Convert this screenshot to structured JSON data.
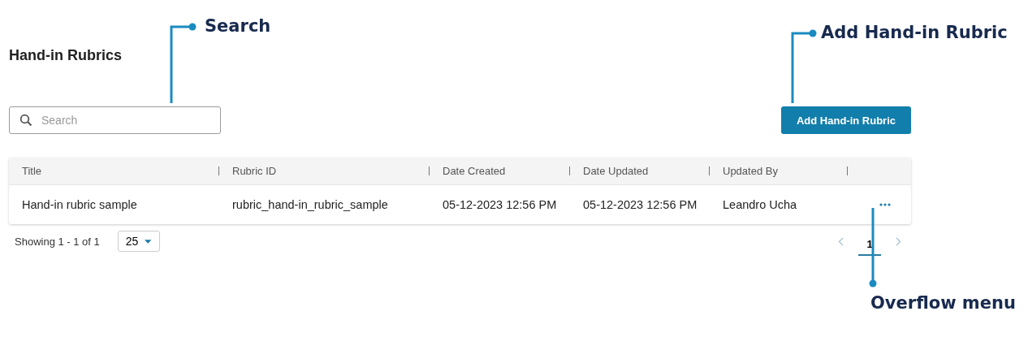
{
  "page_title": "Hand-in Rubrics",
  "search": {
    "placeholder": "Search"
  },
  "add_button": "Add Hand-in Rubric",
  "table": {
    "columns": [
      "Title",
      "Rubric ID",
      "Date Created",
      "Date Updated",
      "Updated By"
    ],
    "rows": [
      {
        "cells": [
          "Hand-in rubric sample",
          "rubric_hand-in_rubric_sample",
          "05-12-2023 12:56 PM",
          "05-12-2023 12:56 PM",
          "Leandro Ucha"
        ]
      }
    ]
  },
  "footer": {
    "showing": "Showing 1 - 1 of 1",
    "page_size": "25",
    "pages": [
      {
        "label": "1",
        "selected": true
      }
    ]
  },
  "annotations": [
    {
      "label": "Search"
    },
    {
      "label": "Add Hand-in Rubric"
    },
    {
      "label": "Overflow menu"
    }
  ]
}
